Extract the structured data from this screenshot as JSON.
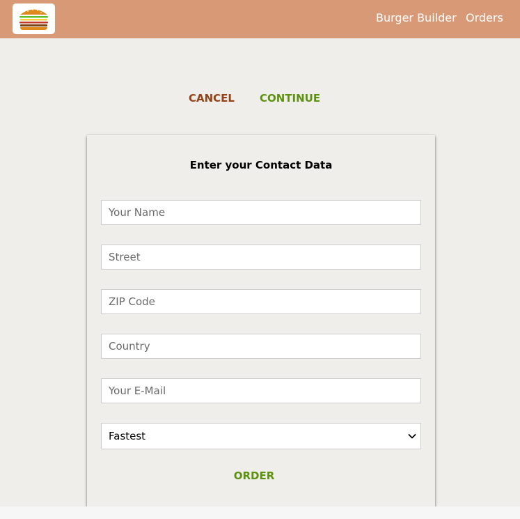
{
  "toolbar": {
    "logo_icon": "burger-logo-icon",
    "nav": {
      "burger_builder": "Burger Builder",
      "orders": "Orders"
    }
  },
  "actions": {
    "cancel_label": "CANCEL",
    "continue_label": "CONTINUE",
    "cancel_color": "#944317",
    "continue_color": "#5c9210"
  },
  "contact_form": {
    "title": "Enter your Contact Data",
    "fields": {
      "name": {
        "value": "",
        "placeholder": "Your Name"
      },
      "street": {
        "value": "",
        "placeholder": "Street"
      },
      "zip": {
        "value": "",
        "placeholder": "ZIP Code"
      },
      "country": {
        "value": "",
        "placeholder": "Country"
      },
      "email": {
        "value": "",
        "placeholder": "Your E-Mail"
      }
    },
    "delivery_method": {
      "selected": "Fastest",
      "icon": "chevron-down-icon"
    },
    "order_label": "ORDER"
  },
  "colors": {
    "toolbar_bg": "#d89a76",
    "page_bg": "#f0eeea"
  }
}
